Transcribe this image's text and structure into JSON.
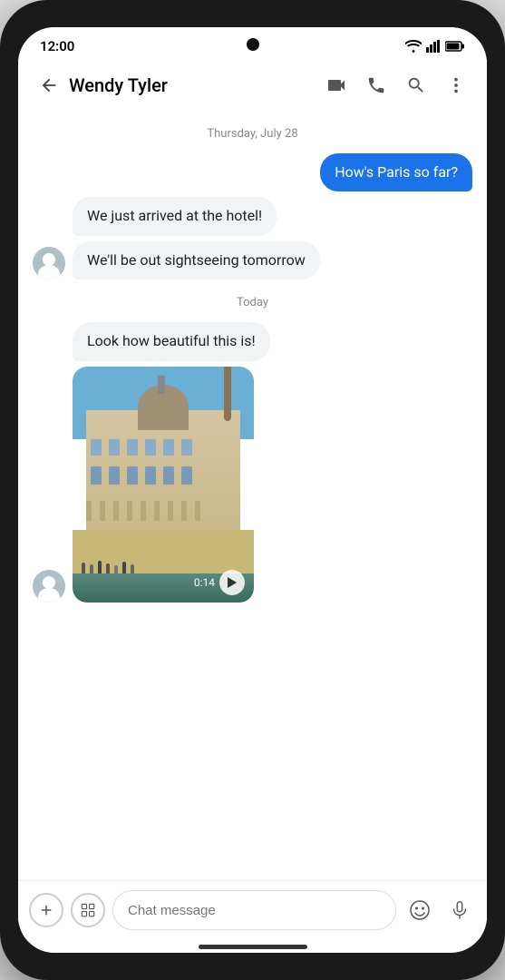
{
  "status": {
    "time": "12:00",
    "signal_icon": "signal",
    "wifi_icon": "wifi",
    "battery_icon": "battery"
  },
  "header": {
    "back_label": "←",
    "contact_name": "Wendy Tyler",
    "video_call_icon": "video-camera",
    "phone_icon": "phone",
    "search_icon": "search",
    "more_icon": "more-vertical"
  },
  "chat": {
    "date_divider_1": "Thursday, July 28",
    "date_divider_2": "Today",
    "messages": [
      {
        "id": 1,
        "type": "sent",
        "text": "How's Paris so far?"
      },
      {
        "id": 2,
        "type": "received",
        "text": "We just arrived at the hotel!"
      },
      {
        "id": 3,
        "type": "received",
        "text": "We'll be out sightseeing tomorrow"
      },
      {
        "id": 4,
        "type": "received",
        "text": "Look how beautiful this is!"
      },
      {
        "id": 5,
        "type": "received-image",
        "duration": "0:14"
      }
    ]
  },
  "input": {
    "placeholder": "Chat message",
    "add_icon": "+",
    "gallery_icon": "gallery",
    "emoji_icon": "emoji",
    "mic_icon": "mic"
  }
}
